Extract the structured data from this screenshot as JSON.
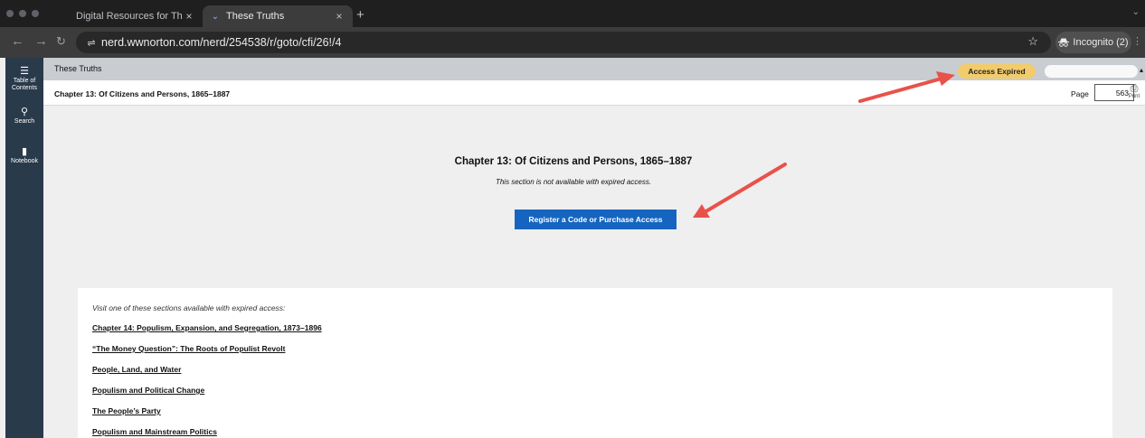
{
  "browser": {
    "tabs": [
      {
        "title": "Digital Resources for These T",
        "active": false
      },
      {
        "title": "These Truths",
        "active": true
      }
    ],
    "new_tab": "+",
    "url": "nerd.wwnorton.com/nerd/254538/r/goto/cfi/26!/4",
    "incognito_label": "Incognito (2)"
  },
  "sidebar": {
    "items": [
      {
        "icon": "list-icon",
        "label": "Table of Contents"
      },
      {
        "icon": "search-icon",
        "label": "Search"
      },
      {
        "icon": "notebook-icon",
        "label": "Notebook"
      }
    ]
  },
  "header": {
    "book_title": "These Truths",
    "access_badge": "Access Expired"
  },
  "chapter_bar": {
    "title": "Chapter 13: Of Citizens and Persons, 1865–1887",
    "page_label": "Page",
    "page_value": "563",
    "print_label": "Print"
  },
  "main": {
    "title": "Chapter 13: Of Citizens and Persons, 1865–1887",
    "subtitle": "This section is not available with expired access.",
    "button_label": "Register a Code or Purchase Access"
  },
  "available_sections": {
    "intro": "Visit one of these sections available with expired access:",
    "links": [
      "Chapter 14: Populism, Expansion, and Segregation, 1873–1896",
      "“The Money Question”: The Roots of Populist Revolt",
      "People, Land, and Water",
      "Populism and Political Change",
      "The People’s Party",
      "Populism and Mainstream Politics"
    ]
  },
  "colors": {
    "annotation_arrow": "#e8524a",
    "badge": "#f2cc6c",
    "button": "#1565c0",
    "rail": "#293a4a"
  }
}
